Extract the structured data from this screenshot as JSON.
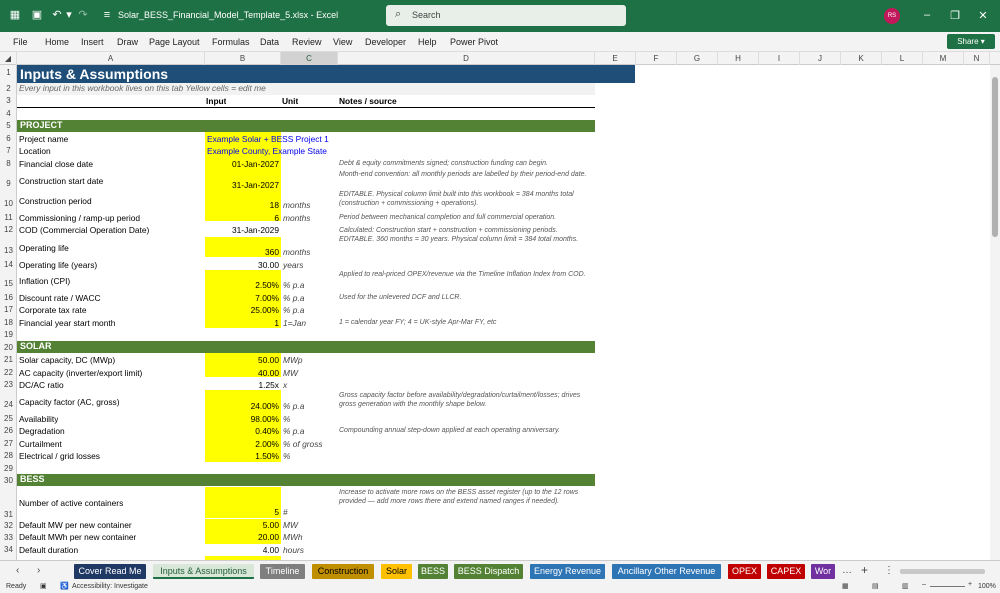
{
  "window": {
    "filename": "Solar_BESS_Financial_Model_Template_5.xlsx",
    "app": "Excel",
    "title_text": "Solar_BESS_Financial_Model_Template_5.xlsx  -  Excel",
    "search_placeholder": "Search",
    "avatar_initials": "RS",
    "share_label": "Share"
  },
  "menu": [
    "File",
    "Home",
    "Insert",
    "Draw",
    "Page Layout",
    "Formulas",
    "Data",
    "Review",
    "View",
    "Developer",
    "Help",
    "Power Pivot"
  ],
  "columns": [
    "A",
    "B",
    "C",
    "D",
    "E",
    "F",
    "G",
    "H",
    "I",
    "J",
    "K",
    "L",
    "M",
    "N"
  ],
  "sheet": {
    "title": "Inputs & Assumptions",
    "subtitle": "Every input in this workbook lives on this tab  Yellow cells = edit me",
    "headers": {
      "input": "Input",
      "unit": "Unit",
      "notes": "Notes / source"
    },
    "sections": {
      "project": "PROJECT",
      "solar": "SOLAR",
      "bess": "BESS"
    },
    "rows": {
      "r6": {
        "label": "Project name",
        "value": "Example Solar + BESS Project 1"
      },
      "r7": {
        "label": "Location",
        "value": "Example County, Example State"
      },
      "r8": {
        "label": "Financial close date",
        "value": "01-Jan-2027",
        "note": "Debt & equity commitments signed; construction funding can begin."
      },
      "r9": {
        "label": "Construction start date",
        "value": "31-Jan-2027",
        "note": "Month-end convention: all monthly periods are labelled by their period-end date."
      },
      "r10": {
        "label": "Construction period",
        "value": "18",
        "unit": "months",
        "note": "EDITABLE. Physical column limit built into this workbook = 384 months total (construction + commissioning + operations)."
      },
      "r11": {
        "label": "Commissioning / ramp-up period",
        "value": "6",
        "unit": "months",
        "note": "Period between mechanical completion and full commercial operation."
      },
      "r12": {
        "label": "COD (Commercial Operation Date)",
        "value": "31-Jan-2029",
        "note": "Calculated: Construction start + construction + commissioning periods."
      },
      "r13": {
        "label": "Operating life",
        "value": "360",
        "unit": "months",
        "note": "EDITABLE. 360 months = 30 years. Physical column limit = 384 total months."
      },
      "r14": {
        "label": "Operating life (years)",
        "value": "30.00",
        "unit": "years"
      },
      "r15": {
        "label": "Inflation (CPI)",
        "value": "2.50%",
        "unit": "% p.a",
        "note": "Applied to real-priced OPEX/revenue via the Timeline Inflation Index from COD."
      },
      "r16": {
        "label": "Discount rate / WACC",
        "value": "7.00%",
        "unit": "% p.a",
        "note": "Used for the unlevered DCF and LLCR."
      },
      "r17": {
        "label": "Corporate tax rate",
        "value": "25.00%",
        "unit": "% p.a"
      },
      "r18": {
        "label": "Financial year start month",
        "value": "1",
        "unit": "1=Jan",
        "note": "1 = calendar year FY; 4 = UK-style Apr-Mar FY, etc"
      },
      "r21": {
        "label": "Solar capacity, DC (MWp)",
        "value": "50.00",
        "unit": "MWp"
      },
      "r22": {
        "label": "AC capacity (inverter/export limit)",
        "value": "40.00",
        "unit": "MW"
      },
      "r23": {
        "label": "DC/AC ratio",
        "value": "1.25x",
        "unit": "x"
      },
      "r24": {
        "label": "Capacity factor (AC, gross)",
        "value": "24.00%",
        "unit": "% p.a",
        "note": "Gross capacity factor before availability/degradation/curtailment/losses; drives gross generation with the monthly shape below."
      },
      "r25": {
        "label": "Availability",
        "value": "98.00%",
        "unit": "%"
      },
      "r26": {
        "label": "Degradation",
        "value": "0.40%",
        "unit": "% p.a",
        "note": "Compounding annual step-down applied at each operating anniversary."
      },
      "r27": {
        "label": "Curtailment",
        "value": "2.00%",
        "unit": "% of gross"
      },
      "r28": {
        "label": "Electrical / grid losses",
        "value": "1.50%",
        "unit": "%"
      },
      "r31": {
        "label": "Number of active containers",
        "value": "5",
        "unit": "#",
        "note": "Increase to activate more rows on the BESS asset register (up to the 12 rows provided — add more rows there and extend named ranges if needed)."
      },
      "r32": {
        "label": "Default MW per new container",
        "value": "5.00",
        "unit": "MW"
      },
      "r33": {
        "label": "Default MWh per new container",
        "value": "20.00",
        "unit": "MWh"
      },
      "r34": {
        "label": "Default duration",
        "value": "4.00",
        "unit": "hours"
      }
    }
  },
  "tabs": [
    {
      "label": "Cover Read Me",
      "bg": "#1f3864",
      "fg": "#ffffff"
    },
    {
      "label": "Inputs & Assumptions",
      "bg": "#d9e7d9",
      "fg": "#1e5c35"
    },
    {
      "label": "Timeline",
      "bg": "#7f7f7f",
      "fg": "#ffffff"
    },
    {
      "label": "Construction",
      "bg": "#bf8f00",
      "fg": "#000000"
    },
    {
      "label": "Solar",
      "bg": "#ffc000",
      "fg": "#000000"
    },
    {
      "label": "BESS",
      "bg": "#548235",
      "fg": "#ffffff"
    },
    {
      "label": "BESS Dispatch",
      "bg": "#548235",
      "fg": "#ffffff"
    },
    {
      "label": "Energy Revenue",
      "bg": "#2e75b6",
      "fg": "#ffffff"
    },
    {
      "label": "Ancillary Other Revenue",
      "bg": "#2e75b6",
      "fg": "#ffffff"
    },
    {
      "label": "OPEX",
      "bg": "#c00000",
      "fg": "#ffffff"
    },
    {
      "label": "CAPEX",
      "bg": "#c00000",
      "fg": "#ffffff"
    },
    {
      "label": "Wor",
      "bg": "#7030a0",
      "fg": "#ffffff"
    }
  ],
  "status": {
    "ready": "Ready",
    "accessibility": "Accessibility: Investigate",
    "zoom": "100%"
  }
}
